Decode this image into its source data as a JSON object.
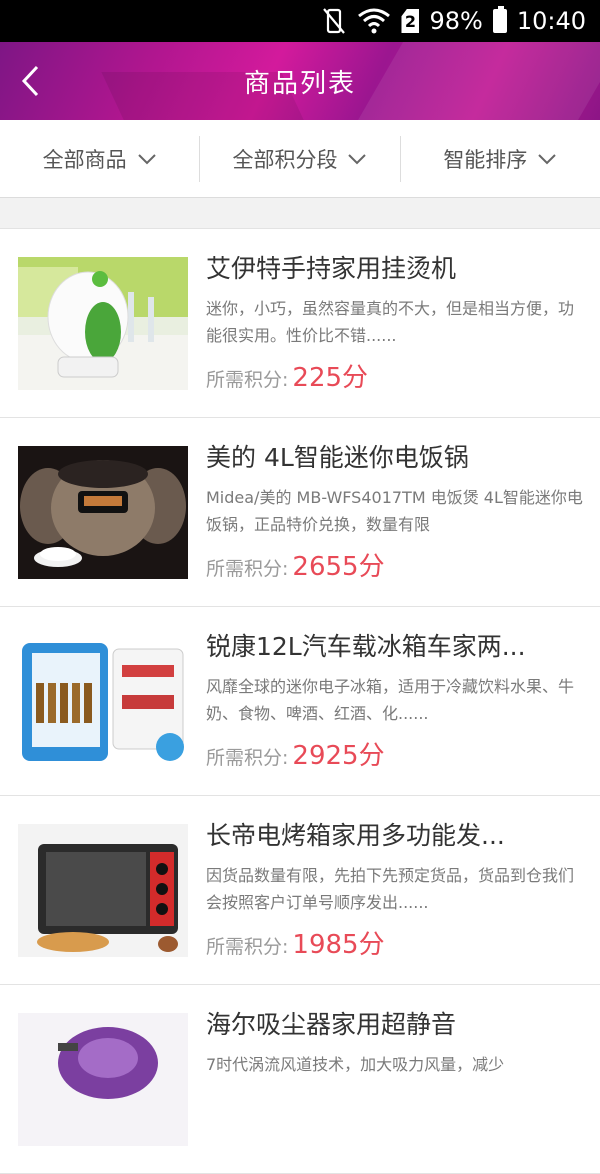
{
  "status_bar": {
    "battery": "98%",
    "time": "10:40",
    "sim": "2"
  },
  "header": {
    "title": "商品列表"
  },
  "filters": [
    {
      "label": "全部商品"
    },
    {
      "label": "全部积分段"
    },
    {
      "label": "智能排序"
    }
  ],
  "products": [
    {
      "name": "艾伊特手持家用挂烫机",
      "desc": "迷你，小巧，虽然容量真的不大，但是相当方便，功能很实用。性价比不错......",
      "price_label": "所需积分:",
      "price": "225分"
    },
    {
      "name": "美的 4L智能迷你电饭锅",
      "desc": "Midea/美的 MB-WFS4017TM 电饭煲 4L智能迷你电饭锅，正品特价兑换，数量有限",
      "price_label": "所需积分:",
      "price": "2655分"
    },
    {
      "name": "锐康12L汽车载冰箱车家两...",
      "desc": "风靡全球的迷你电子冰箱，适用于冷藏饮料水果、牛奶、食物、啤酒、红酒、化......",
      "price_label": "所需积分:",
      "price": "2925分"
    },
    {
      "name": "长帝电烤箱家用多功能发...",
      "desc": "因货品数量有限，先拍下先预定货品，货品到仓我们会按照客户订单号顺序发出......",
      "price_label": "所需积分:",
      "price": "1985分"
    },
    {
      "name": "海尔吸尘器家用超静音",
      "desc": "7时代涡流风道技术，加大吸力风量，减少",
      "price_label": "",
      "price": ""
    }
  ],
  "colors": {
    "header_brand": "#b0168f",
    "price": "#e84a57"
  }
}
